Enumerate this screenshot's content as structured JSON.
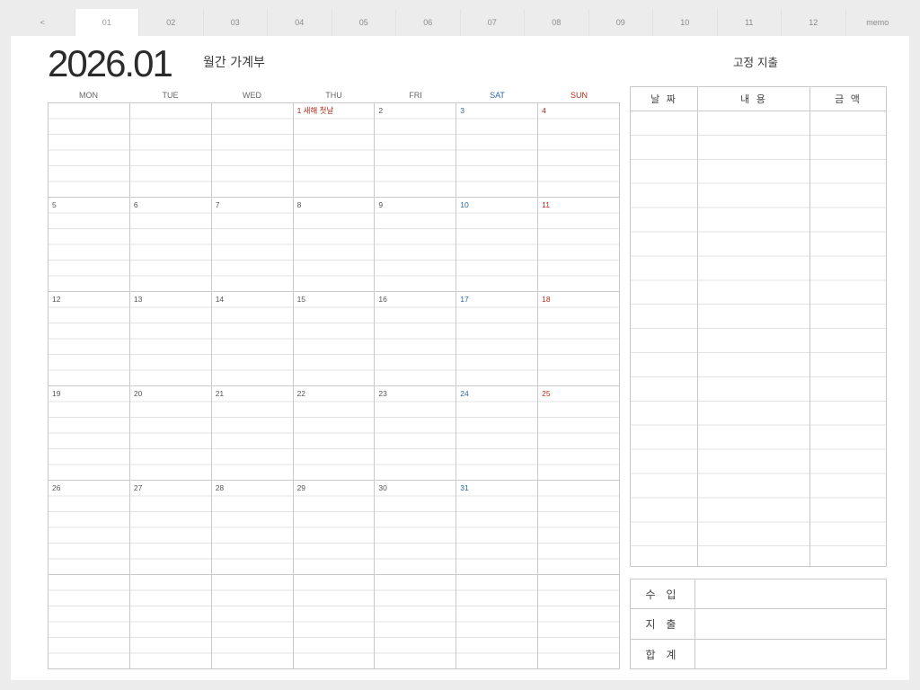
{
  "tabs": [
    {
      "label": "<",
      "name": "tab-prev",
      "active": false
    },
    {
      "label": "01",
      "name": "tab-01",
      "active": true
    },
    {
      "label": "02",
      "name": "tab-02",
      "active": false
    },
    {
      "label": "03",
      "name": "tab-03",
      "active": false
    },
    {
      "label": "04",
      "name": "tab-04",
      "active": false
    },
    {
      "label": "05",
      "name": "tab-05",
      "active": false
    },
    {
      "label": "06",
      "name": "tab-06",
      "active": false
    },
    {
      "label": "07",
      "name": "tab-07",
      "active": false
    },
    {
      "label": "08",
      "name": "tab-08",
      "active": false
    },
    {
      "label": "09",
      "name": "tab-09",
      "active": false
    },
    {
      "label": "10",
      "name": "tab-10",
      "active": false
    },
    {
      "label": "11",
      "name": "tab-11",
      "active": false
    },
    {
      "label": "12",
      "name": "tab-12",
      "active": false
    },
    {
      "label": "memo",
      "name": "tab-memo",
      "active": false
    }
  ],
  "header": {
    "year_month": "2026.01",
    "subtitle": "월간 가계부",
    "fixed_title": "고정 지출"
  },
  "calendar": {
    "weekdays": [
      {
        "label": "MON",
        "kind": "weekday"
      },
      {
        "label": "TUE",
        "kind": "weekday"
      },
      {
        "label": "WED",
        "kind": "weekday"
      },
      {
        "label": "THU",
        "kind": "weekday"
      },
      {
        "label": "FRI",
        "kind": "weekday"
      },
      {
        "label": "SAT",
        "kind": "sat"
      },
      {
        "label": "SUN",
        "kind": "sun"
      }
    ],
    "cells": [
      {
        "text": "",
        "kind": ""
      },
      {
        "text": "",
        "kind": ""
      },
      {
        "text": "",
        "kind": ""
      },
      {
        "text": "1 새해 첫날",
        "kind": "holiday"
      },
      {
        "text": "2",
        "kind": ""
      },
      {
        "text": "3",
        "kind": "sat"
      },
      {
        "text": "4",
        "kind": "sun"
      },
      {
        "text": "5",
        "kind": ""
      },
      {
        "text": "6",
        "kind": ""
      },
      {
        "text": "7",
        "kind": ""
      },
      {
        "text": "8",
        "kind": ""
      },
      {
        "text": "9",
        "kind": ""
      },
      {
        "text": "10",
        "kind": "sat"
      },
      {
        "text": "11",
        "kind": "sun"
      },
      {
        "text": "12",
        "kind": ""
      },
      {
        "text": "13",
        "kind": ""
      },
      {
        "text": "14",
        "kind": ""
      },
      {
        "text": "15",
        "kind": ""
      },
      {
        "text": "16",
        "kind": ""
      },
      {
        "text": "17",
        "kind": "sat"
      },
      {
        "text": "18",
        "kind": "sun"
      },
      {
        "text": "19",
        "kind": ""
      },
      {
        "text": "20",
        "kind": ""
      },
      {
        "text": "21",
        "kind": ""
      },
      {
        "text": "22",
        "kind": ""
      },
      {
        "text": "23",
        "kind": ""
      },
      {
        "text": "24",
        "kind": "sat"
      },
      {
        "text": "25",
        "kind": "sun"
      },
      {
        "text": "26",
        "kind": ""
      },
      {
        "text": "27",
        "kind": ""
      },
      {
        "text": "28",
        "kind": ""
      },
      {
        "text": "29",
        "kind": ""
      },
      {
        "text": "30",
        "kind": ""
      },
      {
        "text": "31",
        "kind": "sat"
      },
      {
        "text": "",
        "kind": ""
      },
      {
        "text": "",
        "kind": ""
      },
      {
        "text": "",
        "kind": ""
      },
      {
        "text": "",
        "kind": ""
      },
      {
        "text": "",
        "kind": ""
      },
      {
        "text": "",
        "kind": ""
      },
      {
        "text": "",
        "kind": ""
      },
      {
        "text": "",
        "kind": ""
      }
    ]
  },
  "fixed_expense": {
    "col_date": "날 짜",
    "col_content": "내 용",
    "col_amount": "금 액"
  },
  "summary": {
    "income": "수 입",
    "expense": "지 출",
    "total": "합 계"
  },
  "colors": {
    "saturday": "#2a66a3",
    "sunday": "#b52b1c",
    "grid": "#c9c9c9"
  }
}
